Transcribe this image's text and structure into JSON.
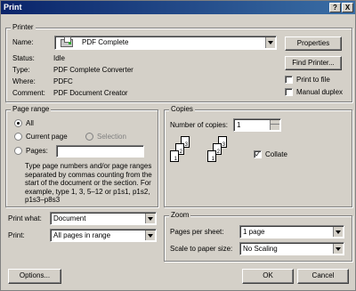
{
  "title": "Print",
  "title_buttons": {
    "help": "?",
    "close": "X"
  },
  "printer": {
    "legend": "Printer",
    "name_label": "Name:",
    "name_value": "PDF Complete",
    "status_label": "Status:",
    "status_value": "Idle",
    "type_label": "Type:",
    "type_value": "PDF Complete Converter",
    "where_label": "Where:",
    "where_value": "PDFC",
    "comment_label": "Comment:",
    "comment_value": "PDF Document Creator",
    "properties": "Properties",
    "find_printer": "Find Printer...",
    "print_to_file": "Print to file",
    "manual_duplex": "Manual duplex"
  },
  "page_range": {
    "legend": "Page range",
    "all": "All",
    "current": "Current page",
    "selection": "Selection",
    "pages": "Pages:",
    "pages_value": "",
    "help": "Type page numbers and/or page ranges separated by commas counting from the start of the document or the section. For example, type 1, 3, 5–12 or p1s1, p1s2, p1s3–p8s3"
  },
  "copies": {
    "legend": "Copies",
    "number_label": "Number of copies:",
    "number_value": "1",
    "collate": "Collate",
    "collate_checked": true
  },
  "print_what": {
    "label": "Print what:",
    "value": "Document"
  },
  "print": {
    "label": "Print:",
    "value": "All pages in range"
  },
  "zoom": {
    "legend": "Zoom",
    "pages_per_sheet_label": "Pages per sheet:",
    "pages_per_sheet_value": "1 page",
    "scale_label": "Scale to paper size:",
    "scale_value": "No Scaling"
  },
  "buttons": {
    "options": "Options...",
    "ok": "OK",
    "cancel": "Cancel"
  },
  "collate_pages": [
    "1",
    "2",
    "3",
    "1",
    "2",
    "3"
  ]
}
